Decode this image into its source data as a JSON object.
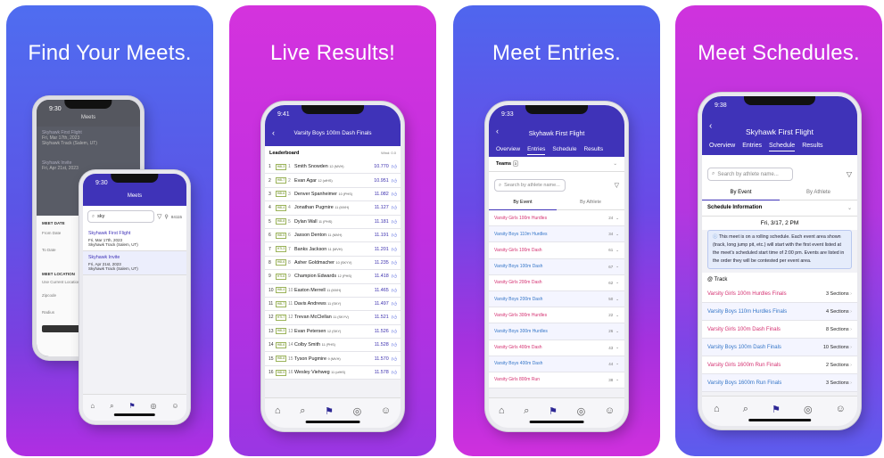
{
  "panels": [
    {
      "headline": "Find Your Meets."
    },
    {
      "headline": "Live Results!"
    },
    {
      "headline": "Meet Entries."
    },
    {
      "headline": "Meet Schedules."
    }
  ],
  "colors": {
    "purple_bar": "#3f33b8",
    "girls": "#d43071",
    "boys": "#3576c8"
  },
  "icons": [
    "home-icon",
    "search-icon",
    "flag-icon",
    "target-icon",
    "person-icon",
    "filter-icon",
    "location-pin-icon",
    "chevron-left-icon",
    "chevron-right-icon",
    "thumbs-up-icon"
  ],
  "find": {
    "back_title": "Meets",
    "back_time": "9:30",
    "back_meet1": "Skyhawk First Flight",
    "back_meet1_date": "Fri, Mar 17th, 2023",
    "back_meet1_loc": "Skyhawk Track (Salem, UT)",
    "back_meet2": "Skyhawk Invite",
    "back_meet2_date": "Fri, Apr 21st, 2023",
    "back_meet2_loc": "Skyhawk Track (Salem, UT)",
    "form": {
      "meet_date": "MEET DATE",
      "from": "From Date",
      "to": "To Date",
      "meet_location": "MEET LOCATION",
      "use_location": "Use Current Location",
      "zip": "Zipcode",
      "radius": "Radius"
    },
    "time": "9:30",
    "title": "Meets",
    "search_value": "sky",
    "zip": "84115",
    "meets": [
      {
        "name": "Skyhawk First Flight",
        "date": "Fri, Mar 17th, 2023",
        "loc": "Skyhawk Track (Salem, UT)"
      },
      {
        "name": "Skyhawk Invite",
        "date": "Fri, Apr 21st, 2023",
        "loc": "Skyhawk Track (Salem, UT)"
      }
    ]
  },
  "live": {
    "time": "9:41",
    "title": "Varsity Boys 100m Dash Finals",
    "section": "Leaderboard",
    "wind": "Wind: 0.0",
    "results": [
      {
        "place": "1",
        "heat": "H8L3",
        "ppl": "1",
        "name": "Smith Snowden",
        "grade": "12 (MVH)",
        "time": "10.770"
      },
      {
        "place": "2",
        "heat": "H8L7",
        "ppl": "2",
        "name": "Evan Agar",
        "grade": "12 (ofHS)",
        "time": "10.951"
      },
      {
        "place": "3",
        "heat": "H8L6",
        "ppl": "3",
        "name": "Denver Spanheimer",
        "grade": "10 (PHS)",
        "time": "11.082"
      },
      {
        "place": "4",
        "heat": "H8L4",
        "ppl": "4",
        "name": "Jonathan Pugmire",
        "grade": "11 (MVH)",
        "time": "11.127"
      },
      {
        "place": "5",
        "heat": "H8L8",
        "ppl": "5",
        "name": "Dylan Wall",
        "grade": "11 (PHS)",
        "time": "11.181"
      },
      {
        "place": "6",
        "heat": "H8L5",
        "ppl": "6",
        "name": "Jaxson Denton",
        "grade": "11 (MVH)",
        "time": "11.191"
      },
      {
        "place": "7",
        "heat": "H7L3",
        "ppl": "7",
        "name": "Banks Jackson",
        "grade": "11 (MVH)",
        "time": "11.201"
      },
      {
        "place": "8",
        "heat": "H6L6",
        "ppl": "8",
        "name": "Asher Goldmacher",
        "grade": "10 (SKYV)",
        "time": "11.235"
      },
      {
        "place": "9",
        "heat": "H7L6",
        "ppl": "9",
        "name": "Champion Edwards",
        "grade": "12 (PHS)",
        "time": "11.418"
      },
      {
        "place": "10",
        "heat": "H8L4",
        "ppl": "10",
        "name": "Easton Merrell",
        "grade": "11 (MVH)",
        "time": "11.465"
      },
      {
        "place": "11",
        "heat": "H8L7",
        "ppl": "11",
        "name": "Davis Andrews",
        "grade": "11 (SKY)",
        "time": "11.497"
      },
      {
        "place": "12",
        "heat": "H7L7",
        "ppl": "12",
        "name": "Trevan McClellan",
        "grade": "11 (SKYV)",
        "time": "11.521"
      },
      {
        "place": "13",
        "heat": "H8L3",
        "ppl": "13",
        "name": "Evan Petersen",
        "grade": "12 (SKY)",
        "time": "11.526"
      },
      {
        "place": "14",
        "heat": "H8L6",
        "ppl": "14",
        "name": "Colby Smith",
        "grade": "11 (PHS)",
        "time": "11.528"
      },
      {
        "place": "15",
        "heat": "H8L8",
        "ppl": "15",
        "name": "Tyson Pugmire",
        "grade": "9 (MVH)",
        "time": "11.570"
      },
      {
        "place": "16",
        "heat": "H8L9",
        "ppl": "16",
        "name": "Wesley Viehweg",
        "grade": "11 (ofHS)",
        "time": "11.578"
      }
    ]
  },
  "entries": {
    "time": "9:33",
    "title": "Skyhawk First Flight",
    "tabs": [
      "Overview",
      "Entries",
      "Schedule",
      "Results"
    ],
    "teams": "Teams",
    "teams_count": "3",
    "search_placeholder": "Search by athlete name...",
    "seg_event": "By Event",
    "seg_athlete": "By Athlete",
    "events": [
      {
        "name": "Varsity Girls 100m Hurdles",
        "count": "24",
        "g": "g"
      },
      {
        "name": "Varsity Boys 110m Hurdles",
        "count": "34",
        "g": "b"
      },
      {
        "name": "Varsity Girls 100m Dash",
        "count": "61",
        "g": "g"
      },
      {
        "name": "Varsity Boys 100m Dash",
        "count": "67",
        "g": "b"
      },
      {
        "name": "Varsity Girls 200m Dash",
        "count": "62",
        "g": "g"
      },
      {
        "name": "Varsity Boys 200m Dash",
        "count": "50",
        "g": "b"
      },
      {
        "name": "Varsity Girls 300m Hurdles",
        "count": "22",
        "g": "g"
      },
      {
        "name": "Varsity Boys 300m Hurdles",
        "count": "26",
        "g": "b"
      },
      {
        "name": "Varsity Girls 400m Dash",
        "count": "43",
        "g": "g"
      },
      {
        "name": "Varsity Boys 400m Dash",
        "count": "44",
        "g": "b"
      },
      {
        "name": "Varsity Girls 800m Run",
        "count": "38",
        "g": "g"
      }
    ]
  },
  "schedule": {
    "time": "9:38",
    "title": "Skyhawk First Flight",
    "tabs": [
      "Overview",
      "Entries",
      "Schedule",
      "Results"
    ],
    "search_placeholder": "Search by athlete name...",
    "seg_event": "By Event",
    "seg_athlete": "By Athlete",
    "info_label": "Schedule Information",
    "date": "Fri, 3/17, 2 PM",
    "notice": "This meet is on a rolling schedule. Each event area shown (track, long jump pit, etc.) will start with the first event listed at the meet's scheduled start time of 2:00 pm. Events are listed in the order they will be contested per event area.",
    "area": "@ Track",
    "events": [
      {
        "name": "Varsity Girls 100m Hurdles Finals",
        "sections": "3 Sections",
        "g": "g"
      },
      {
        "name": "Varsity Boys 110m Hurdles Finals",
        "sections": "4 Sections",
        "g": "b"
      },
      {
        "name": "Varsity Girls 100m Dash Finals",
        "sections": "8 Sections",
        "g": "g"
      },
      {
        "name": "Varsity Boys 100m Dash Finals",
        "sections": "10 Sections",
        "g": "b"
      },
      {
        "name": "Varsity Girls 1600m Run Finals",
        "sections": "2 Sections",
        "g": "g"
      },
      {
        "name": "Varsity Boys 1600m Run Finals",
        "sections": "3 Sections",
        "g": "b"
      }
    ]
  }
}
